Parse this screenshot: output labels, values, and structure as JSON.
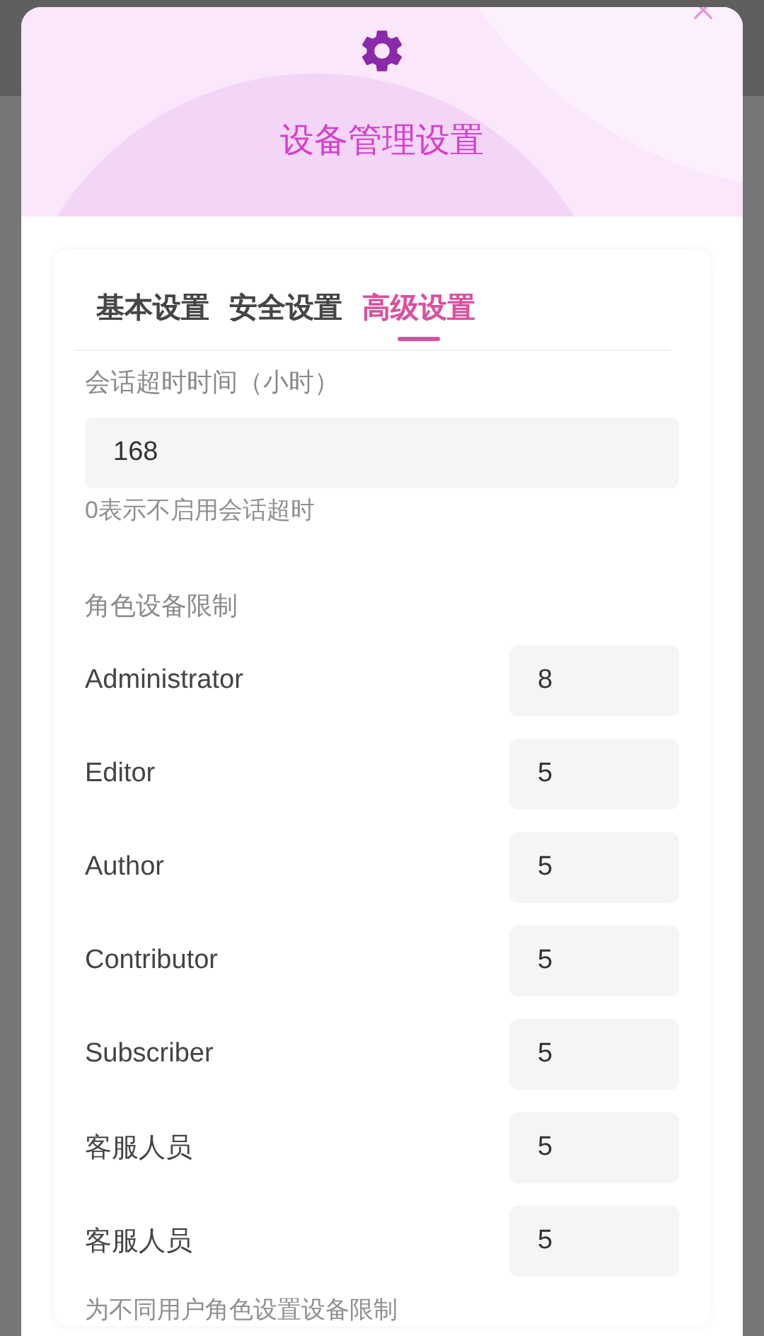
{
  "dialog": {
    "title": "设备管理设置"
  },
  "tabs": [
    {
      "label": "基本设置",
      "selected": false
    },
    {
      "label": "安全设置",
      "selected": false
    },
    {
      "label": "高级设置",
      "selected": true
    }
  ],
  "session_timeout": {
    "label": "会话超时时间（小时）",
    "value": "168",
    "hint": "0表示不启用会话超时"
  },
  "role_limits": {
    "label": "角色设备限制",
    "roles": [
      {
        "name": "Administrator",
        "value": "8"
      },
      {
        "name": "Editor",
        "value": "5"
      },
      {
        "name": "Author",
        "value": "5"
      },
      {
        "name": "Contributor",
        "value": "5"
      },
      {
        "name": "Subscriber",
        "value": "5"
      },
      {
        "name": "客服人员",
        "value": "5"
      },
      {
        "name": "客服人员",
        "value": "5"
      }
    ],
    "hint": "为不同用户角色设置设备限制"
  }
}
